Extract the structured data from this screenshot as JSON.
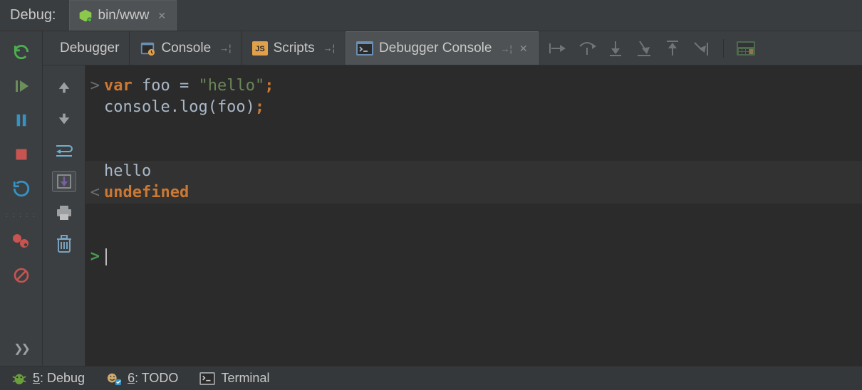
{
  "title": {
    "label": "Debug:",
    "file": "bin/www"
  },
  "tabs": [
    {
      "label": "Debugger",
      "pin": false,
      "close": false,
      "active": false
    },
    {
      "label": "Console",
      "pin": true,
      "close": false,
      "active": false
    },
    {
      "label": "Scripts",
      "pin": true,
      "close": false,
      "active": false
    },
    {
      "label": "Debugger Console",
      "pin": true,
      "close": true,
      "active": true
    }
  ],
  "console": {
    "input_lines": [
      {
        "prefix": ">",
        "tokens": [
          {
            "t": "var ",
            "c": "kw"
          },
          {
            "t": "foo = ",
            "c": "plain"
          },
          {
            "t": "\"hello\"",
            "c": "str"
          },
          {
            "t": ";",
            "c": "kw"
          }
        ]
      },
      {
        "prefix": " ",
        "tokens": [
          {
            "t": "console.log(foo)",
            "c": "plain"
          },
          {
            "t": ";",
            "c": "kw"
          }
        ]
      }
    ],
    "output": "hello",
    "return_prefix": "<",
    "return_value": "undefined",
    "prompt": ">"
  },
  "status_bar": {
    "debug": {
      "key": "5",
      "label": ": Debug"
    },
    "todo": {
      "key": "6",
      "label": ": TODO"
    },
    "terminal": "Terminal"
  }
}
